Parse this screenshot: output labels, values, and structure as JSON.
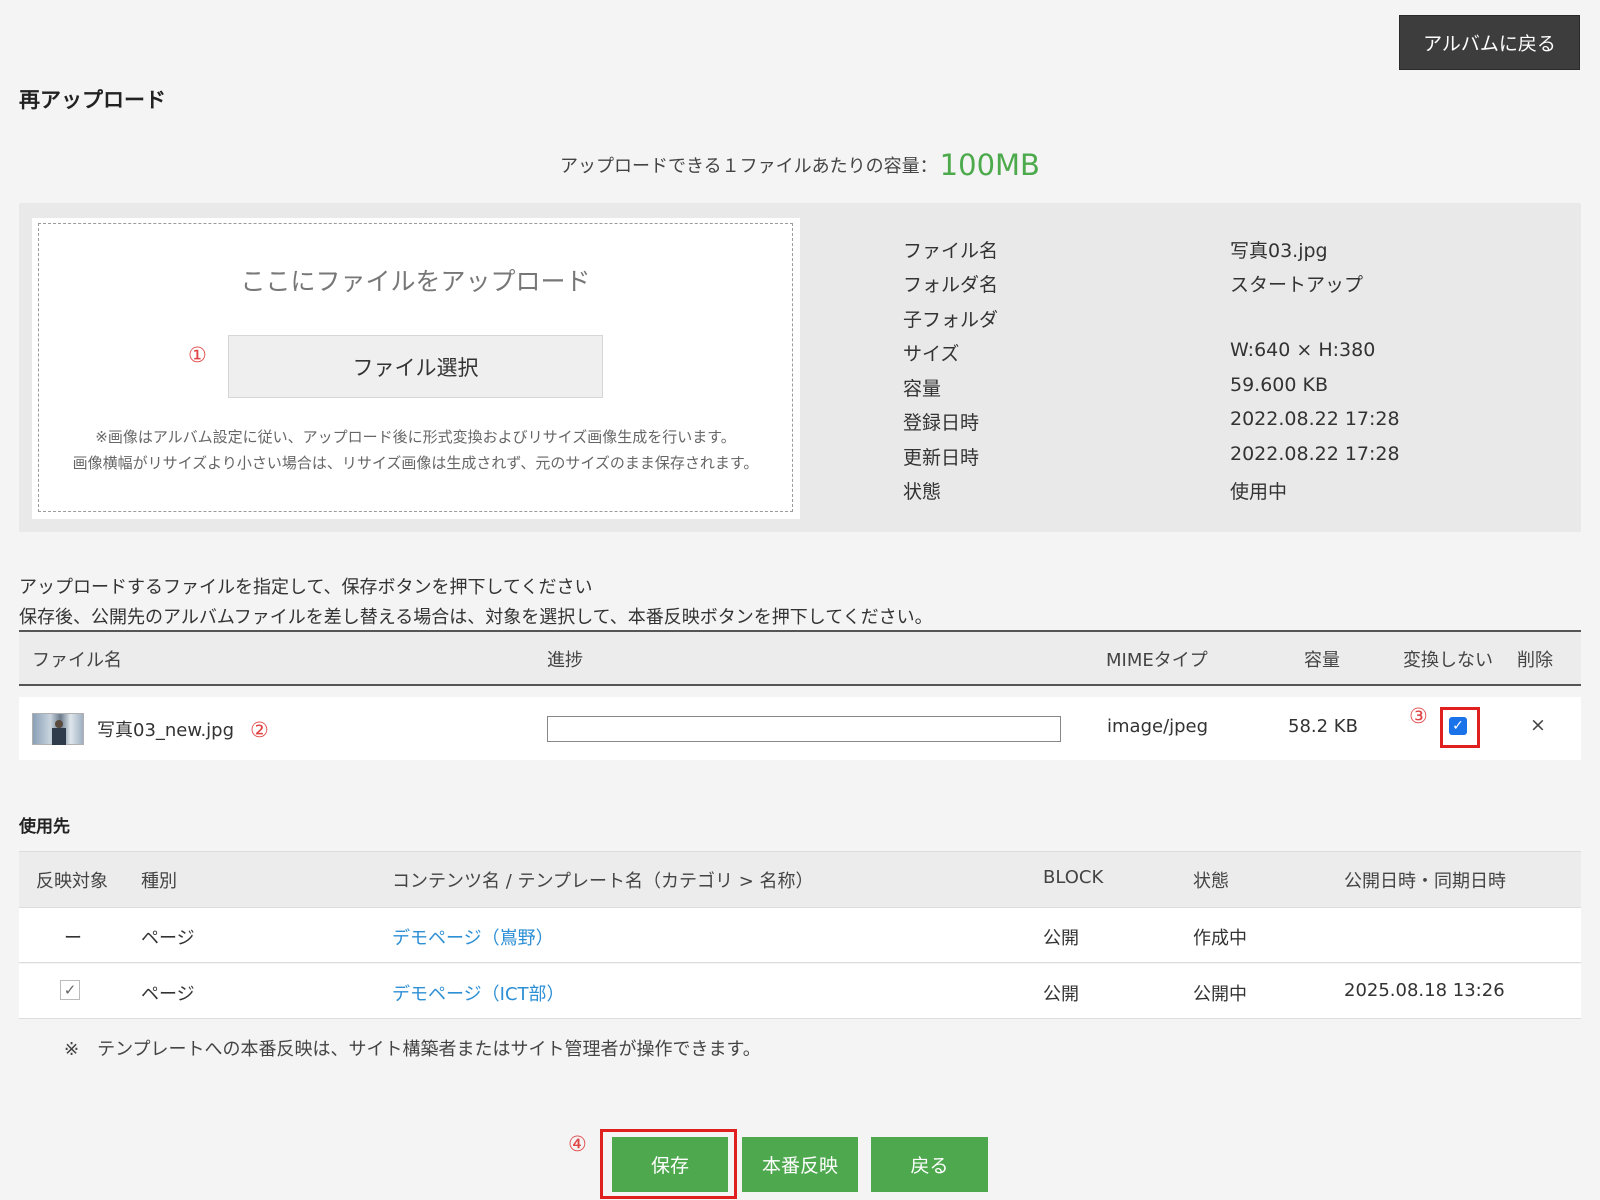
{
  "header": {
    "back_album_label": "アルバムに戻る",
    "title": "再アップロード"
  },
  "capacity": {
    "label": "アップロードできる１ファイルあたりの容量：",
    "value": "100MB"
  },
  "dropzone": {
    "title": "ここにファイルをアップロード",
    "select_label": "ファイル選択",
    "note_line1": "※画像はアルバム設定に従い、アップロード後に形式変換およびリサイズ画像生成を行います。",
    "note_line2": "画像横幅がリサイズより小さい場合は、リサイズ画像は生成されず、元のサイズのまま保存されます。"
  },
  "file_info": [
    {
      "label": "ファイル名",
      "value": "写真03.jpg"
    },
    {
      "label": "フォルダ名",
      "value": "スタートアップ"
    },
    {
      "label": "子フォルダ",
      "value": ""
    },
    {
      "label": "サイズ",
      "value": "W:640 × H:380"
    },
    {
      "label": "容量",
      "value": "59.600 KB"
    },
    {
      "label": "登録日時",
      "value": "2022.08.22 17:28"
    },
    {
      "label": "更新日時",
      "value": "2022.08.22 17:28"
    },
    {
      "label": "状態",
      "value": "使用中"
    }
  ],
  "instructions": {
    "line1": "アップロードするファイルを指定して、保存ボタンを押下してください",
    "line2": "保存後、公開先のアルバムファイルを差し替える場合は、対象を選択して、本番反映ボタンを押下してください。"
  },
  "file_table": {
    "headers": {
      "name": "ファイル名",
      "progress": "進捗",
      "mime": "MIMEタイプ",
      "size": "容量",
      "no_convert": "変換しない",
      "delete": "削除"
    },
    "row": {
      "name": "写真03_new.jpg",
      "progress": 0,
      "mime": "image/jpeg",
      "size": "58.2 KB",
      "no_convert": true,
      "delete": "×"
    }
  },
  "usage": {
    "title": "使用先",
    "headers": {
      "target": "反映対象",
      "type": "種別",
      "content": "コンテンツ名 / テンプレート名（カテゴリ > 名称）",
      "block": "BLOCK",
      "status": "状態",
      "date": "公開日時・同期日時"
    },
    "rows": [
      {
        "target": "ー",
        "type": "ページ",
        "content": "デモページ（嶌野）",
        "block": "公開",
        "status": "作成中",
        "date": ""
      },
      {
        "target_checked": true,
        "type": "ページ",
        "content": "デモページ（ICT部）",
        "block": "公開",
        "status": "公開中",
        "date": "2025.08.18 13:26"
      }
    ],
    "footnote": "※　テンプレートへの本番反映は、サイト構築者またはサイト管理者が操作できます。"
  },
  "markers": {
    "m1": "①",
    "m2": "②",
    "m3": "③",
    "m4": "④"
  },
  "actions": {
    "save": "保存",
    "publish": "本番反映",
    "back": "戻る"
  },
  "colors": {
    "accent_green": "#4ea84e",
    "highlight_red": "#e0201e",
    "link_blue": "#2d8fd5",
    "dark_button": "#3d3d3d"
  }
}
